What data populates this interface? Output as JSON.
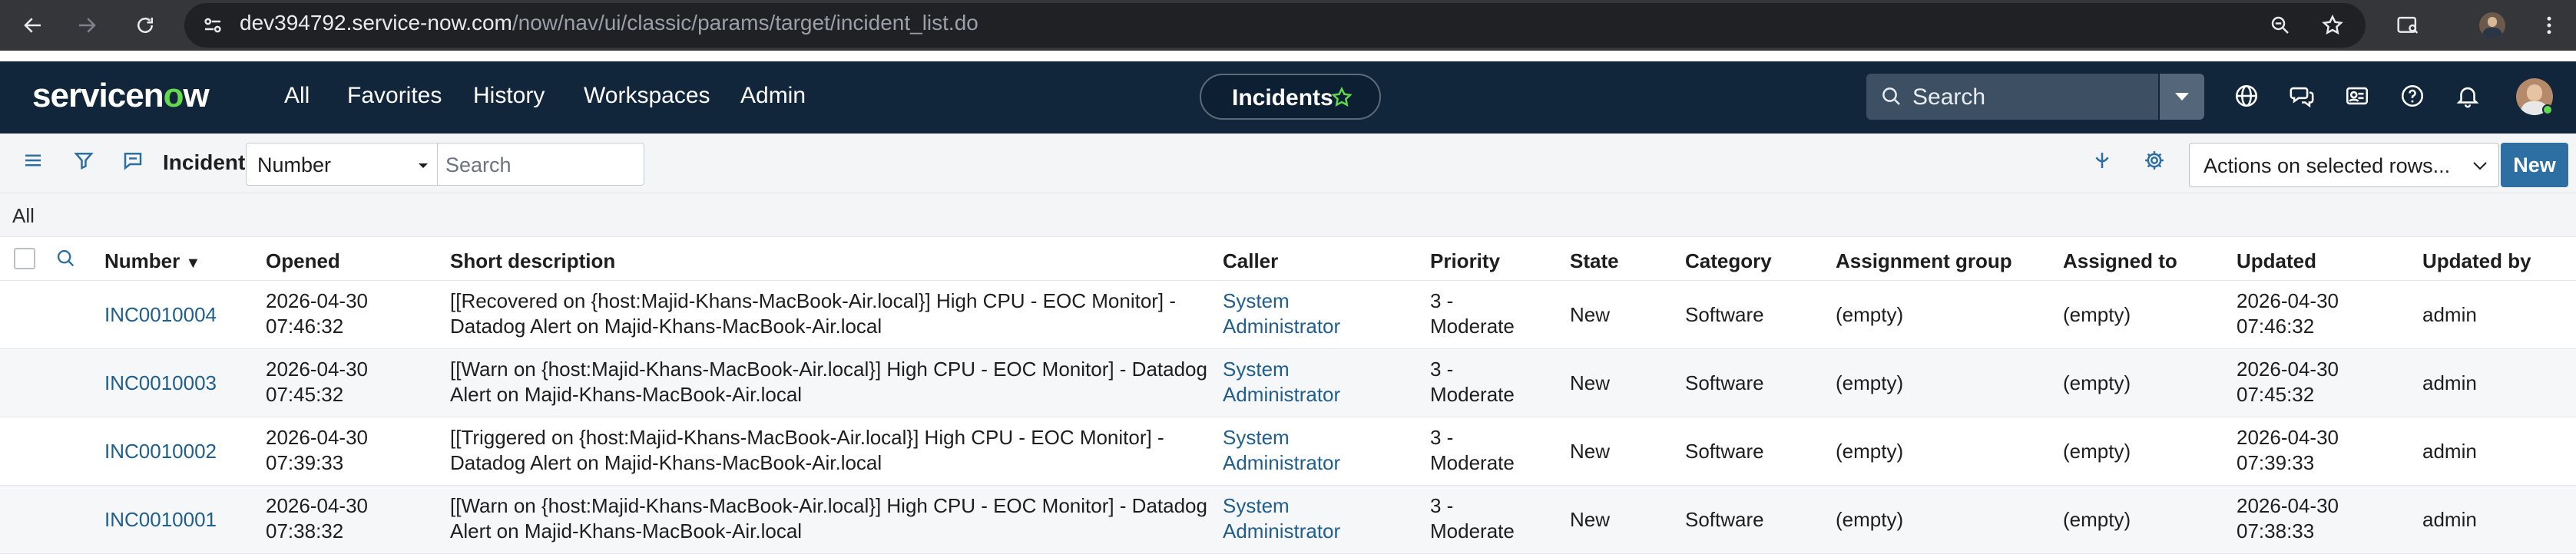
{
  "browser": {
    "url_host": "dev394792.service-now.com",
    "url_path": "/now/nav/ui/classic/params/target/incident_list.do"
  },
  "header": {
    "logo_pre": "servicen",
    "logo_o": "o",
    "logo_post": "w",
    "nav": [
      "All",
      "Favorites",
      "History",
      "Workspaces",
      "Admin"
    ],
    "context_title": "Incidents",
    "search_label": "Search",
    "accent_color": "#62d84e"
  },
  "toolbar": {
    "list_title": "Incidents",
    "field_select": "Number",
    "search_placeholder": "Search",
    "actions_select": "Actions on selected rows...",
    "new_label": "New"
  },
  "breadcrumb": "All",
  "table": {
    "columns": [
      "Number",
      "Opened",
      "Short description",
      "Caller",
      "Priority",
      "State",
      "Category",
      "Assignment group",
      "Assigned to",
      "Updated",
      "Updated by"
    ],
    "sort_indicator": "▼",
    "rows": [
      {
        "number": "INC0010004",
        "opened_date": "2026-04-30",
        "opened_time": "07:46:32",
        "desc_line1": "[[Recovered on {host:Majid-Khans-MacBook-Air.local}] High CPU - EOC Monitor] -",
        "desc_line2": "Datadog Alert on Majid-Khans-MacBook-Air.local",
        "caller_line1": "System",
        "caller_line2": "Administrator",
        "priority_line1": "3 -",
        "priority_line2": "Moderate",
        "state": "New",
        "category": "Software",
        "assignment_group": "(empty)",
        "assigned_to": "(empty)",
        "updated_date": "2026-04-30",
        "updated_time": "07:46:32",
        "updated_by": "admin"
      },
      {
        "number": "INC0010003",
        "opened_date": "2026-04-30",
        "opened_time": "07:45:32",
        "desc_line1": "[[Warn on {host:Majid-Khans-MacBook-Air.local}] High CPU - EOC Monitor] - Datadog",
        "desc_line2": "Alert on Majid-Khans-MacBook-Air.local",
        "caller_line1": "System",
        "caller_line2": "Administrator",
        "priority_line1": "3 -",
        "priority_line2": "Moderate",
        "state": "New",
        "category": "Software",
        "assignment_group": "(empty)",
        "assigned_to": "(empty)",
        "updated_date": "2026-04-30",
        "updated_time": "07:45:32",
        "updated_by": "admin"
      },
      {
        "number": "INC0010002",
        "opened_date": "2026-04-30",
        "opened_time": "07:39:33",
        "desc_line1": "[[Triggered on {host:Majid-Khans-MacBook-Air.local}] High CPU - EOC Monitor] -",
        "desc_line2": "Datadog Alert on Majid-Khans-MacBook-Air.local",
        "caller_line1": "System",
        "caller_line2": "Administrator",
        "priority_line1": "3 -",
        "priority_line2": "Moderate",
        "state": "New",
        "category": "Software",
        "assignment_group": "(empty)",
        "assigned_to": "(empty)",
        "updated_date": "2026-04-30",
        "updated_time": "07:39:33",
        "updated_by": "admin"
      },
      {
        "number": "INC0010001",
        "opened_date": "2026-04-30",
        "opened_time": "07:38:32",
        "desc_line1": "[[Warn on {host:Majid-Khans-MacBook-Air.local}] High CPU - EOC Monitor] - Datadog",
        "desc_line2": "Alert on Majid-Khans-MacBook-Air.local",
        "caller_line1": "System",
        "caller_line2": "Administrator",
        "priority_line1": "3 -",
        "priority_line2": "Moderate",
        "state": "New",
        "category": "Software",
        "assignment_group": "(empty)",
        "assigned_to": "(empty)",
        "updated_date": "2026-04-30",
        "updated_time": "07:38:33",
        "updated_by": "admin"
      }
    ]
  }
}
